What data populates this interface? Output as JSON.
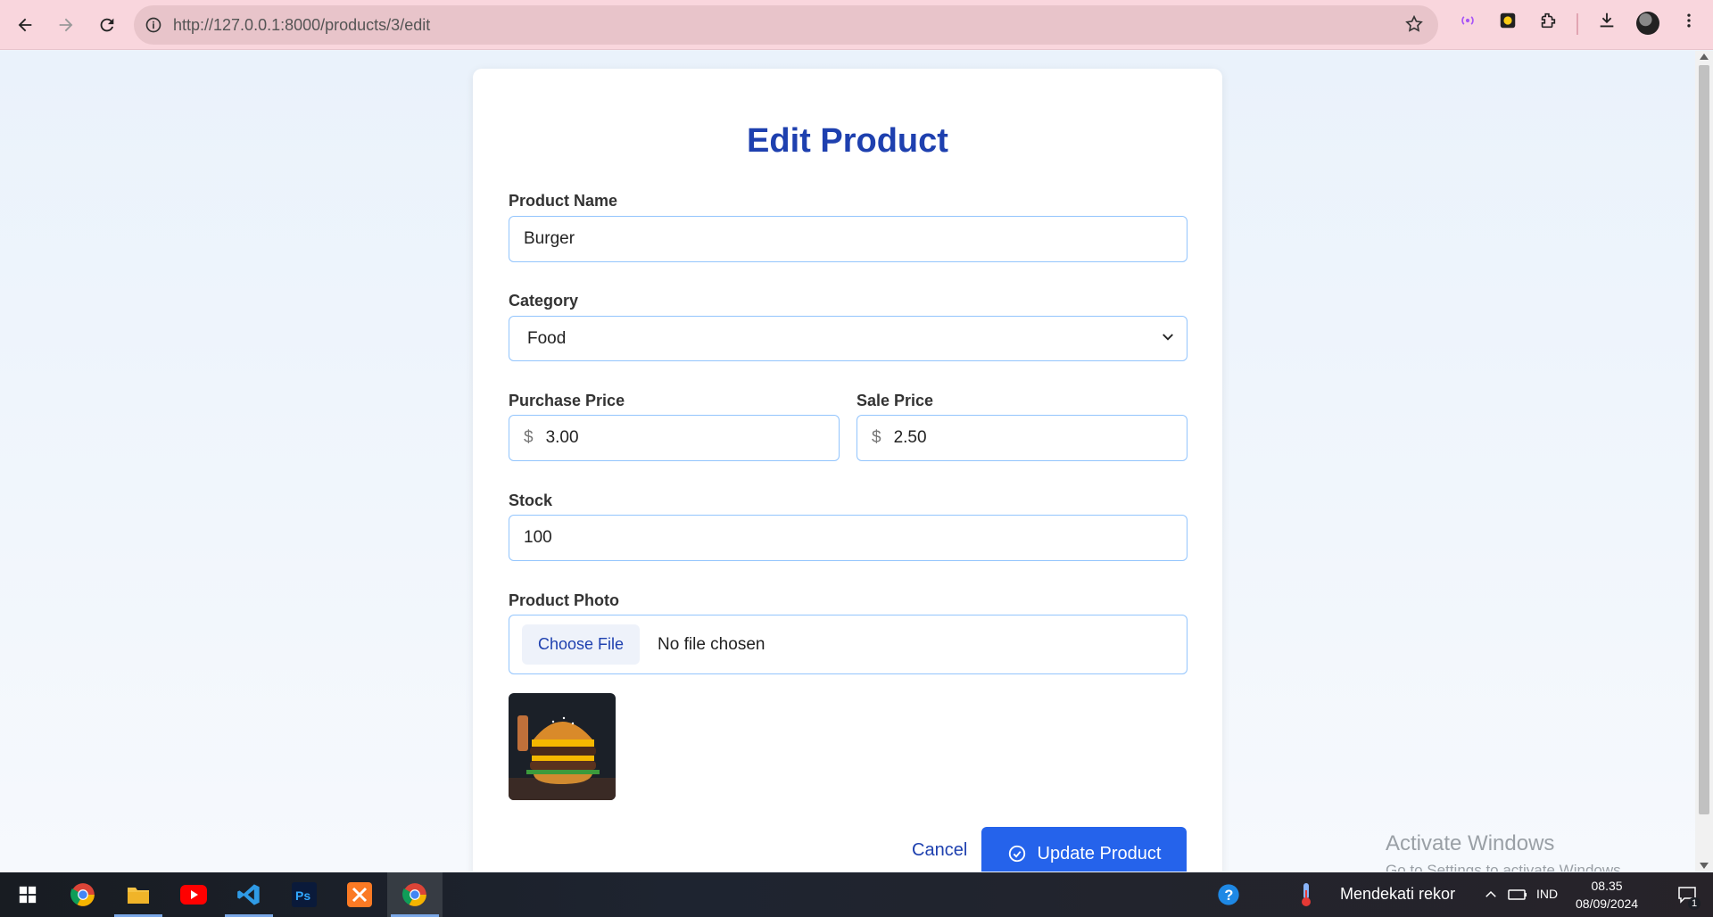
{
  "browser": {
    "url": "http://127.0.0.1:8000/products/3/edit"
  },
  "form": {
    "title": "Edit Product",
    "product_name_label": "Product Name",
    "product_name_value": "Burger",
    "category_label": "Category",
    "category_value": "Food",
    "purchase_price_label": "Purchase Price",
    "purchase_price_prefix": "$",
    "purchase_price_value": "3.00",
    "sale_price_label": "Sale Price",
    "sale_price_prefix": "$",
    "sale_price_value": "2.50",
    "stock_label": "Stock",
    "stock_value": "100",
    "photo_label": "Product Photo",
    "choose_file_label": "Choose File",
    "no_file_text": "No file chosen",
    "cancel_label": "Cancel",
    "update_label": "Update Product"
  },
  "watermark": {
    "line1": "Activate Windows",
    "line2": "Go to Settings to activate Windows."
  },
  "taskbar": {
    "weather_text": "Mendekati rekor",
    "language": "IND",
    "time": "08.35",
    "date": "08/09/2024",
    "notification_count": "1"
  },
  "colors": {
    "accent": "#2563eb",
    "title": "#1e40af",
    "chrome": "#f9d6dd"
  }
}
